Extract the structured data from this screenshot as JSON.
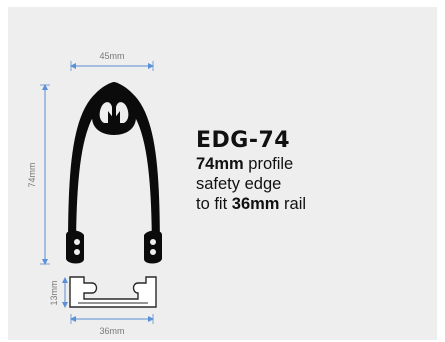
{
  "diagram": {
    "dimensions": {
      "top_width": "45mm",
      "height": "74mm",
      "rail_height": "13mm",
      "rail_width": "36mm"
    },
    "colors": {
      "background": "#eeeeee",
      "profile": "#0b0b0b",
      "rail": "#ffffff",
      "dimension_line": "#5b8fd6"
    }
  },
  "product": {
    "code": "EDG-74",
    "line1_bold": "74mm",
    "line1_rest": " profile",
    "line2": "safety edge",
    "line3_pre": "to fit ",
    "line3_bold": "36mm",
    "line3_post": " rail"
  }
}
